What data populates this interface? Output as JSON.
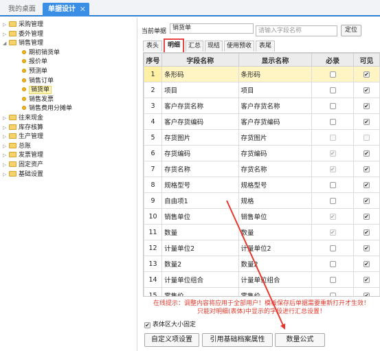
{
  "top_tabs": {
    "home": "我的桌面",
    "current": "单据设计",
    "close_glyph": "✕"
  },
  "tree": [
    {
      "label": "采购管理",
      "level": 0,
      "type": "folder",
      "expanded": false
    },
    {
      "label": "委外管理",
      "level": 0,
      "type": "folder",
      "expanded": false
    },
    {
      "label": "销售管理",
      "level": 0,
      "type": "folder",
      "expanded": true
    },
    {
      "label": "期初销货单",
      "level": 1,
      "type": "leaf"
    },
    {
      "label": "报价单",
      "level": 1,
      "type": "leaf"
    },
    {
      "label": "预测单",
      "level": 1,
      "type": "leaf"
    },
    {
      "label": "销售订单",
      "level": 1,
      "type": "leaf"
    },
    {
      "label": "销货单",
      "level": 1,
      "type": "leaf",
      "selected": true
    },
    {
      "label": "销售发票",
      "level": 1,
      "type": "leaf"
    },
    {
      "label": "销售费用分摊单",
      "level": 1,
      "type": "leaf"
    },
    {
      "label": "往来现金",
      "level": 0,
      "type": "folder",
      "expanded": false
    },
    {
      "label": "库存核算",
      "level": 0,
      "type": "folder",
      "expanded": false
    },
    {
      "label": "生产管理",
      "level": 0,
      "type": "folder",
      "expanded": false
    },
    {
      "label": "总账",
      "level": 0,
      "type": "folder",
      "expanded": false
    },
    {
      "label": "发票管理",
      "level": 0,
      "type": "folder",
      "expanded": false
    },
    {
      "label": "固定资产",
      "level": 0,
      "type": "folder",
      "expanded": false
    },
    {
      "label": "基础设置",
      "level": 0,
      "type": "folder",
      "expanded": false
    }
  ],
  "form": {
    "current_label": "当前单据",
    "current_value": "销货单",
    "search_placeholder": "请输入字段名称",
    "locate_button": "定位"
  },
  "tabs": [
    "表头",
    "明细",
    "汇总",
    "现结",
    "使用预收",
    "表尾"
  ],
  "active_tab": "明细",
  "grid": {
    "headers": [
      "序号",
      "字段名称",
      "显示名称",
      "必录",
      "可见"
    ],
    "rows": [
      {
        "no": "1",
        "field": "条形码",
        "display": "条形码",
        "required": false,
        "req_disabled": false,
        "visible": true,
        "selected": true
      },
      {
        "no": "2",
        "field": "项目",
        "display": "项目",
        "required": false,
        "req_disabled": false,
        "visible": true
      },
      {
        "no": "3",
        "field": "客户存货名称",
        "display": "客户存货名称",
        "required": false,
        "req_disabled": false,
        "visible": true
      },
      {
        "no": "4",
        "field": "客户存货编码",
        "display": "客户存货编码",
        "required": false,
        "req_disabled": false,
        "visible": true
      },
      {
        "no": "5",
        "field": "存货图片",
        "display": "存货图片",
        "required": false,
        "req_disabled": true,
        "visible": false
      },
      {
        "no": "6",
        "field": "存货编码",
        "display": "存货编码",
        "required": true,
        "req_disabled": true,
        "visible": true
      },
      {
        "no": "7",
        "field": "存货名称",
        "display": "存货名称",
        "required": true,
        "req_disabled": true,
        "visible": true
      },
      {
        "no": "8",
        "field": "规格型号",
        "display": "规格型号",
        "required": false,
        "req_disabled": false,
        "visible": true
      },
      {
        "no": "9",
        "field": "自由项1",
        "display": "规格",
        "required": false,
        "req_disabled": false,
        "visible": true
      },
      {
        "no": "10",
        "field": "销售单位",
        "display": "销售单位",
        "required": true,
        "req_disabled": true,
        "visible": true
      },
      {
        "no": "11",
        "field": "数量",
        "display": "数量",
        "required": true,
        "req_disabled": true,
        "visible": true
      },
      {
        "no": "12",
        "field": "计量单位2",
        "display": "计量单位2",
        "required": false,
        "req_disabled": false,
        "visible": true
      },
      {
        "no": "13",
        "field": "数量2",
        "display": "数量2",
        "required": false,
        "req_disabled": false,
        "visible": true
      },
      {
        "no": "14",
        "field": "计量单位组合",
        "display": "计量单位组合",
        "required": false,
        "req_disabled": false,
        "visible": true
      },
      {
        "no": "15",
        "field": "零售价",
        "display": "零售价",
        "required": false,
        "req_disabled": false,
        "visible": true
      }
    ]
  },
  "notice": {
    "line1": "在线提示：调整内容将应用于全部用户！模板保存后单据需要重新打开才生效！",
    "line2": "只能对明细(表体)中显示的字段进行汇总设置！"
  },
  "fix_size": {
    "label": "表体区大小固定",
    "checked": true
  },
  "buttons": {
    "custom": "自定义项设置",
    "reference": "引用基础档案属性",
    "quantity_formula": "数量公式"
  },
  "colors": {
    "accent": "#3a8ee6",
    "annotation_red": "#e8362f",
    "selected_row": "#fff5c4"
  },
  "icons": {
    "folder": "folder-icon",
    "leaf": "document-dot-icon",
    "close": "close-icon",
    "tree_toggle": "expand-toggle-icon"
  }
}
